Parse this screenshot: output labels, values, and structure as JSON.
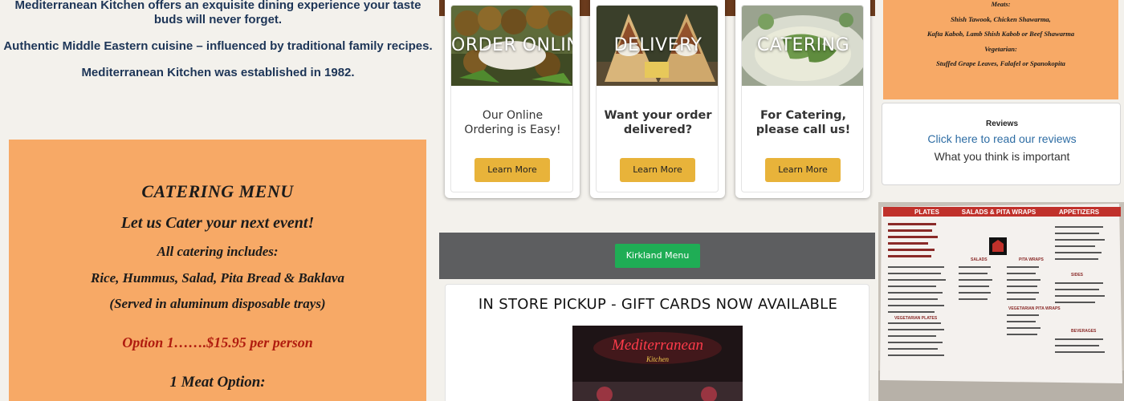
{
  "about": {
    "line1": "Mediterranean Kitchen offers an exquisite dining experience your taste buds will never forget.",
    "line2": "Authentic Middle Eastern cuisine – influenced by traditional family recipes.",
    "line3": "Mediterranean Kitchen was established in 1982."
  },
  "catering_menu": {
    "title": "CATERING MENU",
    "subtitle": "Let us Cater your next event!",
    "includes_label": "All catering includes:",
    "includes_items": "Rice, Hummus, Salad, Pita Bread & Baklava",
    "served_note": "(Served in aluminum disposable trays)",
    "option_1": "Option 1…….$15.95 per person",
    "meat_option": "1 Meat Option:"
  },
  "cards": [
    {
      "photo_label": "ORDER ONLINE",
      "desc_line1": "Our Online",
      "desc_line2": "Ordering is Easy!",
      "button": "Learn More"
    },
    {
      "photo_label": "DELIVERY",
      "desc_line1": "Want your order",
      "desc_line2": "delivered?",
      "button": "Learn More"
    },
    {
      "photo_label": "CATERING",
      "desc_line1": "For Catering,",
      "desc_line2": "please call us!",
      "button": "Learn More"
    }
  ],
  "kirkland_button": "Kirkland Menu",
  "pickup": {
    "title": "IN STORE PICKUP - GIFT CARDS NOW AVAILABLE",
    "sign_text": "Mediterranean",
    "sign_subtext": "Kitchen"
  },
  "menu_snippet": {
    "meats_label": "Meats:",
    "meats_line1": "Shish Tawook, Chicken Shawarma,",
    "meats_line2": "Kafta Kabob, Lamb Shish Kabob or Beef Shawarma",
    "veg_label": "Vegetarian:",
    "veg_line": "Stuffed Grape Leaves, Falafel or Spanokopita"
  },
  "reviews": {
    "title": "Reviews",
    "link_text": "Click here to read our reviews",
    "note": "What you think is important"
  },
  "menu_board": {
    "heading_left": "PLATES",
    "heading_mid": "SALADS & PITA WRAPS",
    "heading_right": "APPETIZERS",
    "sub_salads": "SALADS",
    "sub_pita": "PITA WRAPS",
    "sub_veg_plates": "VEGETARIAN PLATES",
    "sub_veg_pita": "VEGETARIAN PITA WRAPS",
    "sub_sides": "SIDES",
    "sub_beverages": "BEVERAGES"
  },
  "colors": {
    "accent_orange": "#f7a966",
    "button_gold": "#e8b33a",
    "button_green": "#1fad55",
    "text_navy": "#1d3557",
    "price_red": "#b01c0f",
    "link_blue": "#2e6da4"
  }
}
